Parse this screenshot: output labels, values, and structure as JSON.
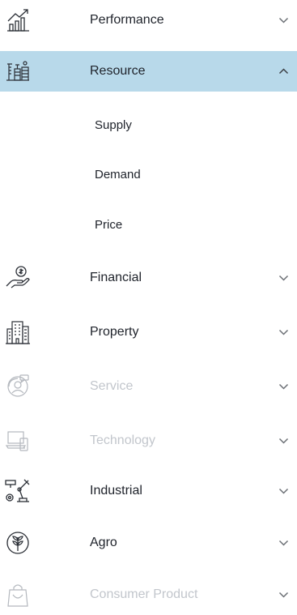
{
  "menu": {
    "items": [
      {
        "label": "Performance",
        "icon": "chart-growth-icon",
        "state": "collapsed"
      },
      {
        "label": "Resource",
        "icon": "resource-tools-icon",
        "state": "expanded",
        "children": [
          {
            "label": "Supply"
          },
          {
            "label": "Demand"
          },
          {
            "label": "Price"
          }
        ]
      },
      {
        "label": "Financial",
        "icon": "hand-money-icon",
        "state": "collapsed"
      },
      {
        "label": "Property",
        "icon": "building-icon",
        "state": "collapsed"
      },
      {
        "label": "Service",
        "icon": "customer-service-icon",
        "state": "disabled"
      },
      {
        "label": "Technology",
        "icon": "devices-icon",
        "state": "disabled"
      },
      {
        "label": "Industrial",
        "icon": "robot-arm-icon",
        "state": "collapsed"
      },
      {
        "label": "Agro",
        "icon": "plant-icon",
        "state": "collapsed"
      },
      {
        "label": "Consumer Product",
        "icon": "shopping-bag-icon",
        "state": "disabled"
      }
    ]
  },
  "colors": {
    "active_background": "#b8d9ea",
    "text": "#20242c",
    "disabled_text": "#c2c6cc",
    "chevron": "#6b6f75"
  }
}
